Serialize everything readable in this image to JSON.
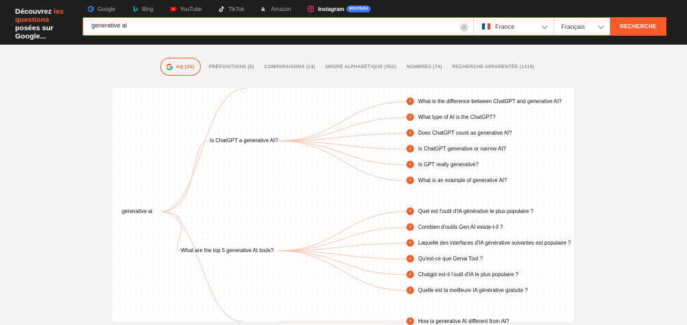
{
  "brand": {
    "part1": "Découvrez",
    "part2": "les",
    "part3": "questions",
    "part4": "posées sur Google..."
  },
  "sources": [
    {
      "label": "Google",
      "icon": "google-icon"
    },
    {
      "label": "Bing",
      "icon": "bing-icon"
    },
    {
      "label": "YouTube",
      "icon": "youtube-icon"
    },
    {
      "label": "TikTok",
      "icon": "tiktok-icon"
    },
    {
      "label": "Amazon",
      "icon": "amazon-icon"
    },
    {
      "label": "Instagram",
      "icon": "instagram-icon",
      "badge": "NOUVEAU",
      "active": true
    }
  ],
  "search": {
    "value": "generative ai",
    "country": "France",
    "language": "Français",
    "button": "RECHERCHE"
  },
  "filters": [
    {
      "label": "AQ [25]",
      "active": true
    },
    {
      "label": "PRÉPOSITIONS [5]"
    },
    {
      "label": "COMPARAISONS [13]"
    },
    {
      "label": "ORDRE ALPHABÉTIQUE [352]"
    },
    {
      "label": "NOMBRES [74]"
    },
    {
      "label": "RECHERCHE APPARENTÉE [1319]"
    }
  ],
  "tree": {
    "root": "generative ai",
    "branches": [
      {
        "label": "Is ChatGPT a generative AI?",
        "leaves": [
          "What is the difference between ChatGPT and generative AI?",
          "What type of AI is the ChatGPT?",
          "Does ChatGPT count as generative AI?",
          "Is ChatGPT generative or narrow AI?",
          "Is GPT really generative?",
          "What is an example of generative AI?"
        ]
      },
      {
        "label": "What are the top 5 generative AI tools?",
        "leaves": [
          "Quel est l'outil d'IA générative le plus populaire ?",
          "Combien d'outils Gen AI existe-t-il ?",
          "Laquelle des interfaces d'IA générative suivantes est populaire  ?",
          "Qu'est-ce que Genai Tool ?",
          "Chatgpt est-il l'outil d'IA le plus populaire ?",
          "Quelle est la meilleure IA générative gratuite ?"
        ]
      }
    ],
    "partial_leaf": "How is generative AI different from AI?"
  },
  "colors": {
    "accent": "#ff5a2a",
    "header": "#1f1f1f",
    "badge": "#3a78ff",
    "link": "#f8c8b4"
  }
}
